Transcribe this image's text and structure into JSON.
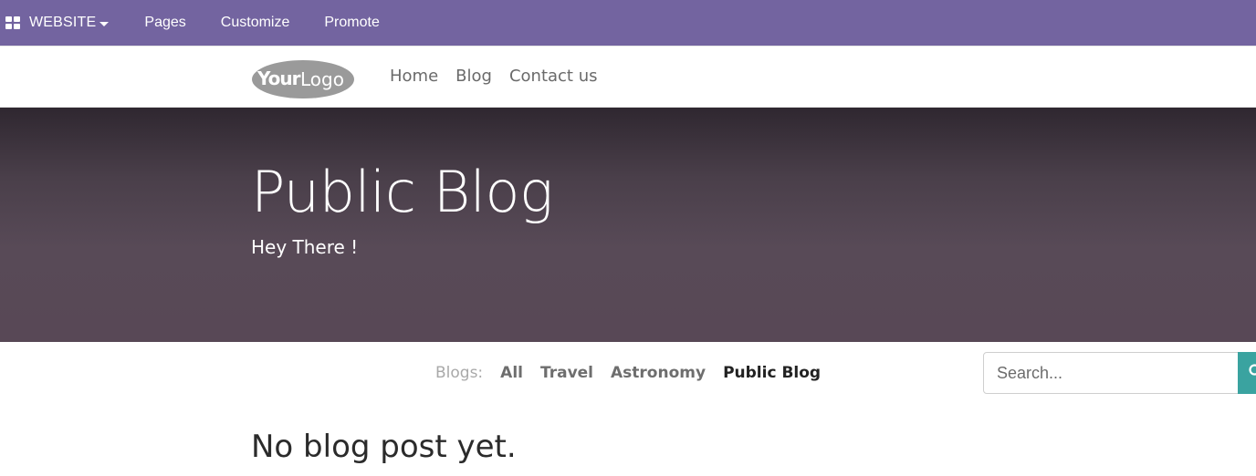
{
  "admin_bar": {
    "brand": "WEBSITE",
    "menu": [
      "Pages",
      "Customize",
      "Promote"
    ]
  },
  "site": {
    "logo_text_bold": "Your",
    "logo_text_light": "Logo",
    "nav": [
      "Home",
      "Blog",
      "Contact us"
    ]
  },
  "hero": {
    "title": "Public Blog",
    "subtitle": "Hey There !"
  },
  "blogs": {
    "label": "Blogs:",
    "items": [
      "All",
      "Travel",
      "Astronomy",
      "Public Blog"
    ],
    "active": "Public Blog"
  },
  "search": {
    "placeholder": "Search..."
  },
  "main": {
    "empty_message": "No blog post yet."
  },
  "colors": {
    "admin_bar": "#7364a0",
    "hero": "#584a57",
    "search_button": "#3aa3a0"
  },
  "icons": {
    "apps": "grid-icon",
    "search": "search-icon",
    "caret": "caret-down-icon"
  }
}
